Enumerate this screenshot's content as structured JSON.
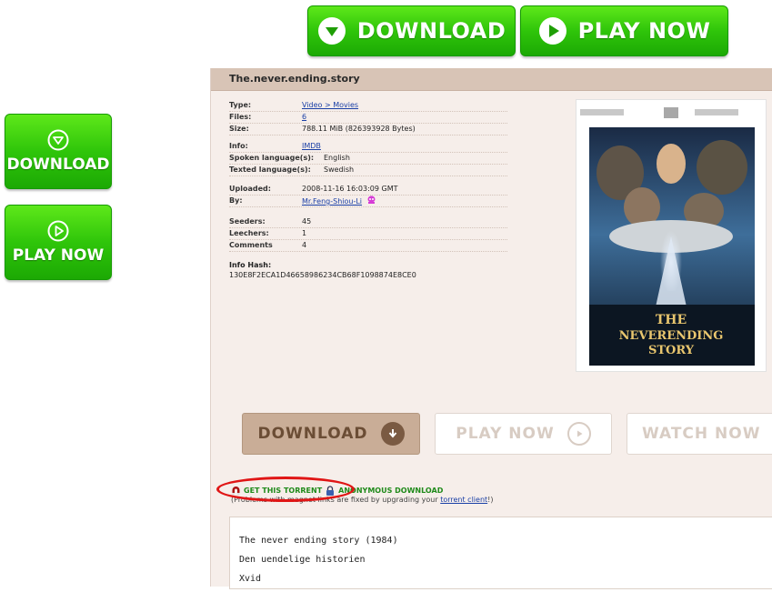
{
  "ads": {
    "top_download_label": "DOWNLOAD",
    "top_play_label": "PLAY NOW",
    "side_download_label": "DOWNLOAD",
    "side_play_label": "PLAY NOW"
  },
  "torrent": {
    "title": "The.never.ending.story",
    "details": [
      {
        "key": "Type:",
        "value": "Video > Movies",
        "link": true
      },
      {
        "key": "Files:",
        "value": "6",
        "link": true
      },
      {
        "key": "Size:",
        "value": "788.11 MiB (826393928 Bytes)",
        "link": false
      },
      {
        "key": "Info:",
        "value": "IMDB",
        "link": true
      },
      {
        "key": "Spoken language(s):",
        "value": "English",
        "link": false
      },
      {
        "key": "Texted language(s):",
        "value": "Swedish",
        "link": false
      },
      {
        "key": "Uploaded:",
        "value": "2008-11-16 16:03:09 GMT",
        "link": false
      },
      {
        "key": "By:",
        "value": "Mr.Feng-Shiou-Li",
        "link": true
      },
      {
        "key": "Seeders:",
        "value": "45",
        "link": false
      },
      {
        "key": "Leechers:",
        "value": "1",
        "link": false
      },
      {
        "key": "Comments",
        "value": "4",
        "link": false
      }
    ],
    "info_hash_label": "Info Hash:",
    "info_hash": "130E8F2ECA1D46658986234CB68F1098874E8CE0",
    "poster": {
      "line1": "THE",
      "line2": "NEVERENDING",
      "line3": "STORY"
    }
  },
  "actions": {
    "download": "DOWNLOAD",
    "play": "PLAY NOW",
    "watch": "WATCH NOW"
  },
  "links": {
    "get_torrent": "GET THIS TORRENT",
    "anonymous": "ANONYMOUS DOWNLOAD",
    "note_prefix": "(Problems with magnet links are fixed by upgrading your ",
    "note_link": "torrent client",
    "note_suffix": "!)"
  },
  "description": {
    "lines": [
      "The never ending story (1984)",
      "Den uendelige historien",
      "Xvid"
    ]
  },
  "colors": {
    "ad_green": "#2fc50a",
    "panel_bg": "#f6eeea",
    "title_bar": "#d8c4b6",
    "download_bg": "#c9ad97",
    "annotation_red": "#e01515"
  }
}
